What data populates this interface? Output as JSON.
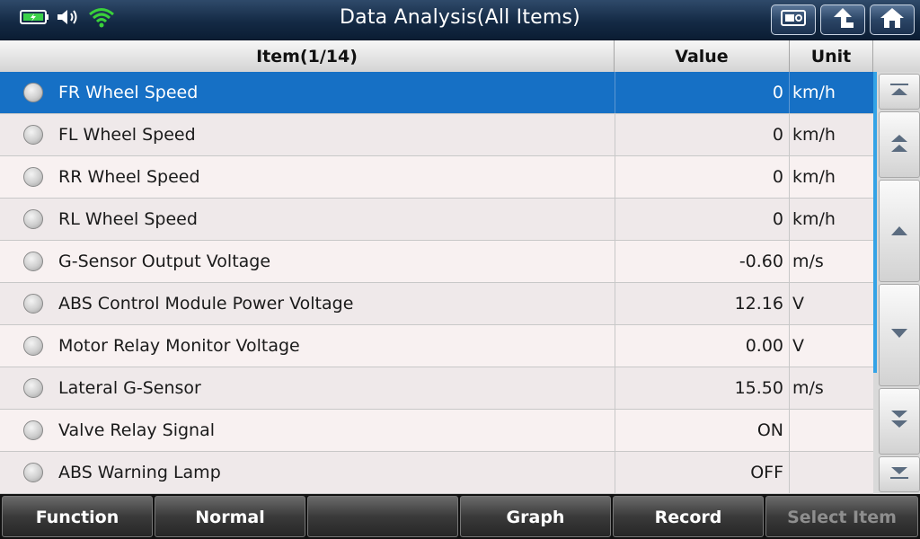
{
  "header": {
    "title": "Data Analysis(All Items)"
  },
  "table": {
    "columns": {
      "item": "Item(1/14)",
      "value": "Value",
      "unit": "Unit"
    },
    "rows": [
      {
        "name": "FR Wheel Speed",
        "value": "0",
        "unit": "km/h"
      },
      {
        "name": "FL Wheel Speed",
        "value": "0",
        "unit": "km/h"
      },
      {
        "name": "RR Wheel Speed",
        "value": "0",
        "unit": "km/h"
      },
      {
        "name": "RL Wheel Speed",
        "value": "0",
        "unit": "km/h"
      },
      {
        "name": "G-Sensor Output Voltage",
        "value": "-0.60",
        "unit": "m/s"
      },
      {
        "name": "ABS Control Module Power Voltage",
        "value": "12.16",
        "unit": "V"
      },
      {
        "name": "Motor Relay Monitor Voltage",
        "value": "0.00",
        "unit": "V"
      },
      {
        "name": "Lateral G-Sensor",
        "value": "15.50",
        "unit": "m/s"
      },
      {
        "name": "Valve Relay Signal",
        "value": "ON",
        "unit": ""
      },
      {
        "name": "ABS Warning Lamp",
        "value": "OFF",
        "unit": ""
      }
    ]
  },
  "toolbar": {
    "function_label": "Function",
    "normal_label": "Normal",
    "blank_label": "",
    "graph_label": "Graph",
    "record_label": "Record",
    "select_item_label": "Select Item"
  },
  "icons": {
    "battery": "battery-charging-icon",
    "volume": "speaker-icon",
    "wifi": "wifi-icon",
    "screenshot": "screenshot-icon",
    "back": "back-arrow-icon",
    "home": "home-icon"
  },
  "colors": {
    "selected_row": "#1670c5",
    "wifi": "#3ad13a",
    "battery": "#3bd14a",
    "scroll_indicator": "#34a3e6",
    "disabled_text": "#8e8e8e"
  }
}
